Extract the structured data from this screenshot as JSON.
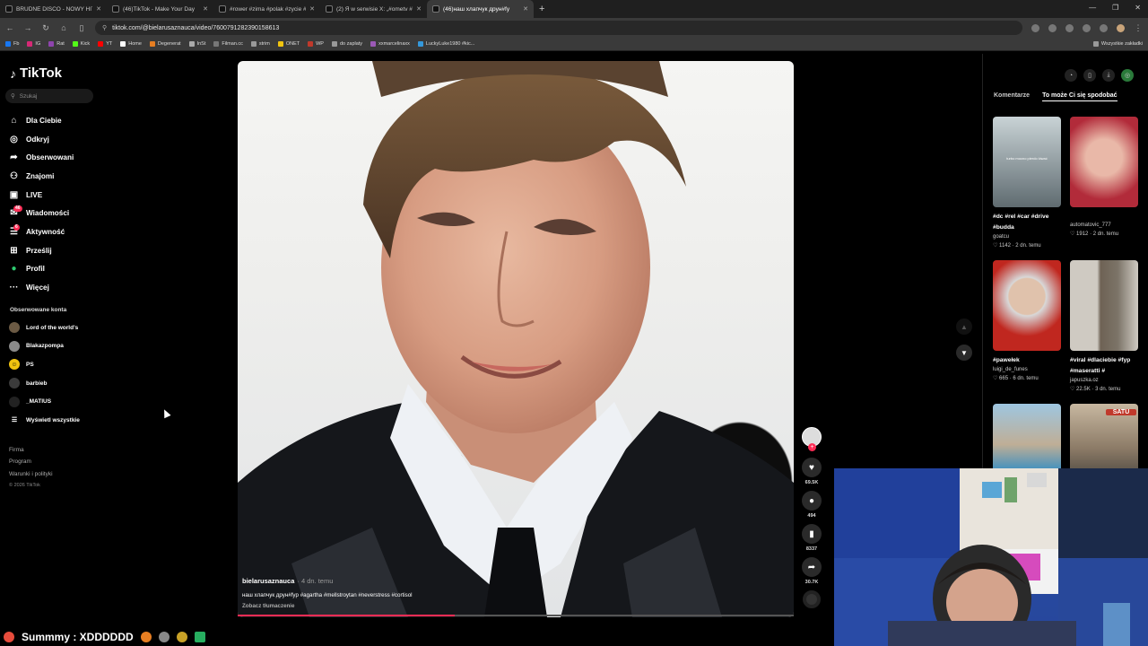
{
  "browser": {
    "tabs": [
      {
        "title": "BRUDNE DISCO - NOWY HIT Z",
        "active": false
      },
      {
        "title": "(46)TikTok - Make Your Day",
        "active": false
      },
      {
        "title": "#rower #zima #polak #zycie #",
        "active": false
      },
      {
        "title": "(2) Я w serwisie X: „#ometv #r",
        "active": false
      },
      {
        "title": "(46)наш хлапчук друн#fy",
        "active": true
      }
    ],
    "url": "tiktok.com/@bielarusaznauca/video/7600791282390158613",
    "bookmarks": [
      "Fb",
      "IG",
      "Rat",
      "Kick",
      "YT",
      "Home",
      "Degenerat",
      "InSt",
      "Filman.cc",
      "strim",
      "ONET",
      "WP",
      "do zaplaty",
      "xxmarcelinaxx",
      "LuckyLuke1980 #kic..."
    ],
    "bookmarks_all": "Wszystkie zakładki"
  },
  "sidebar": {
    "logo": "TikTok",
    "search_placeholder": "Szukaj",
    "nav": [
      {
        "label": "Dla Ciebie",
        "icon": "home-icon",
        "glyph": "⌂"
      },
      {
        "label": "Odkryj",
        "icon": "compass-icon",
        "glyph": "◎"
      },
      {
        "label": "Obserwowani",
        "icon": "following-icon",
        "glyph": "➦"
      },
      {
        "label": "Znajomi",
        "icon": "friends-icon",
        "glyph": "⚇"
      },
      {
        "label": "LIVE",
        "icon": "live-icon",
        "glyph": "▣"
      },
      {
        "label": "Wiadomości",
        "icon": "messages-icon",
        "glyph": "✉",
        "badge": "46"
      },
      {
        "label": "Aktywność",
        "icon": "activity-icon",
        "glyph": "☰",
        "badge": "6"
      },
      {
        "label": "Prześlij",
        "icon": "upload-icon",
        "glyph": "⊞"
      },
      {
        "label": "Profil",
        "icon": "profile-icon",
        "glyph": "●"
      },
      {
        "label": "Więcej",
        "icon": "more-icon",
        "glyph": "···"
      }
    ],
    "followed_title": "Obserwowane konta",
    "followed": [
      "Lord of the world's",
      "Blakazpompa",
      "PS",
      "barbieb",
      "_MATIUS"
    ],
    "show_all": "Wyświetl wszystkie",
    "footer": [
      "Firma",
      "Program",
      "Warunki i polityki"
    ],
    "copyright": "© 2026 TikTok"
  },
  "video": {
    "author": "bielarusaznauca",
    "date": "· 4 dn. temu",
    "caption": "наш хлапчук друн#fyp #agartha #mellstroytan #neverstress #cortisol",
    "translate": "Zobacz tłumaczenie",
    "progress": 0.39,
    "likes": "69.5K",
    "comments": "494",
    "saves": "8337",
    "shares": "30.7K"
  },
  "right_panel": {
    "tabs": [
      "Komentarze",
      "To może Ci się spodobać"
    ],
    "cards": [
      {
        "title": "#dc #rel #car #drive #budda",
        "user": "goatcu",
        "likes": "1142",
        "date": "2 dn. temu",
        "thumb_text": "turbo mocno pierdo kiwać",
        "colors": [
          "#b9c4c8",
          "#5f6b70"
        ]
      },
      {
        "title": "",
        "user": "automatovic_777",
        "likes": "1912",
        "date": "2 dn. temu",
        "thumb_text": "",
        "colors": [
          "#e9b8a8",
          "#b22b3a"
        ]
      },
      {
        "title": "#pawełek",
        "user": "luigi_de_funes",
        "likes": "665",
        "date": "6 dn. temu",
        "thumb_text": "",
        "colors": [
          "#d8c2b0",
          "#c0271f"
        ]
      },
      {
        "title": "#viral #dlaciebie #fyp #maseratti #",
        "user": "japuszka.oz",
        "likes": "22.5K",
        "date": "3 dn. temu",
        "thumb_text": "",
        "colors": [
          "#7c7468",
          "#cfcac2"
        ]
      },
      {
        "title": "",
        "user": "",
        "likes": "",
        "date": "",
        "thumb_text": "",
        "colors": [
          "#9ec6e0",
          "#3a8fc1"
        ]
      },
      {
        "title": "",
        "user": "",
        "likes": "",
        "date": "",
        "thumb_text": "SATU",
        "colors": [
          "#c7b7a0",
          "#2f2f2f"
        ]
      }
    ]
  },
  "ticker": {
    "text": "Summmy : XDDDDDD"
  }
}
